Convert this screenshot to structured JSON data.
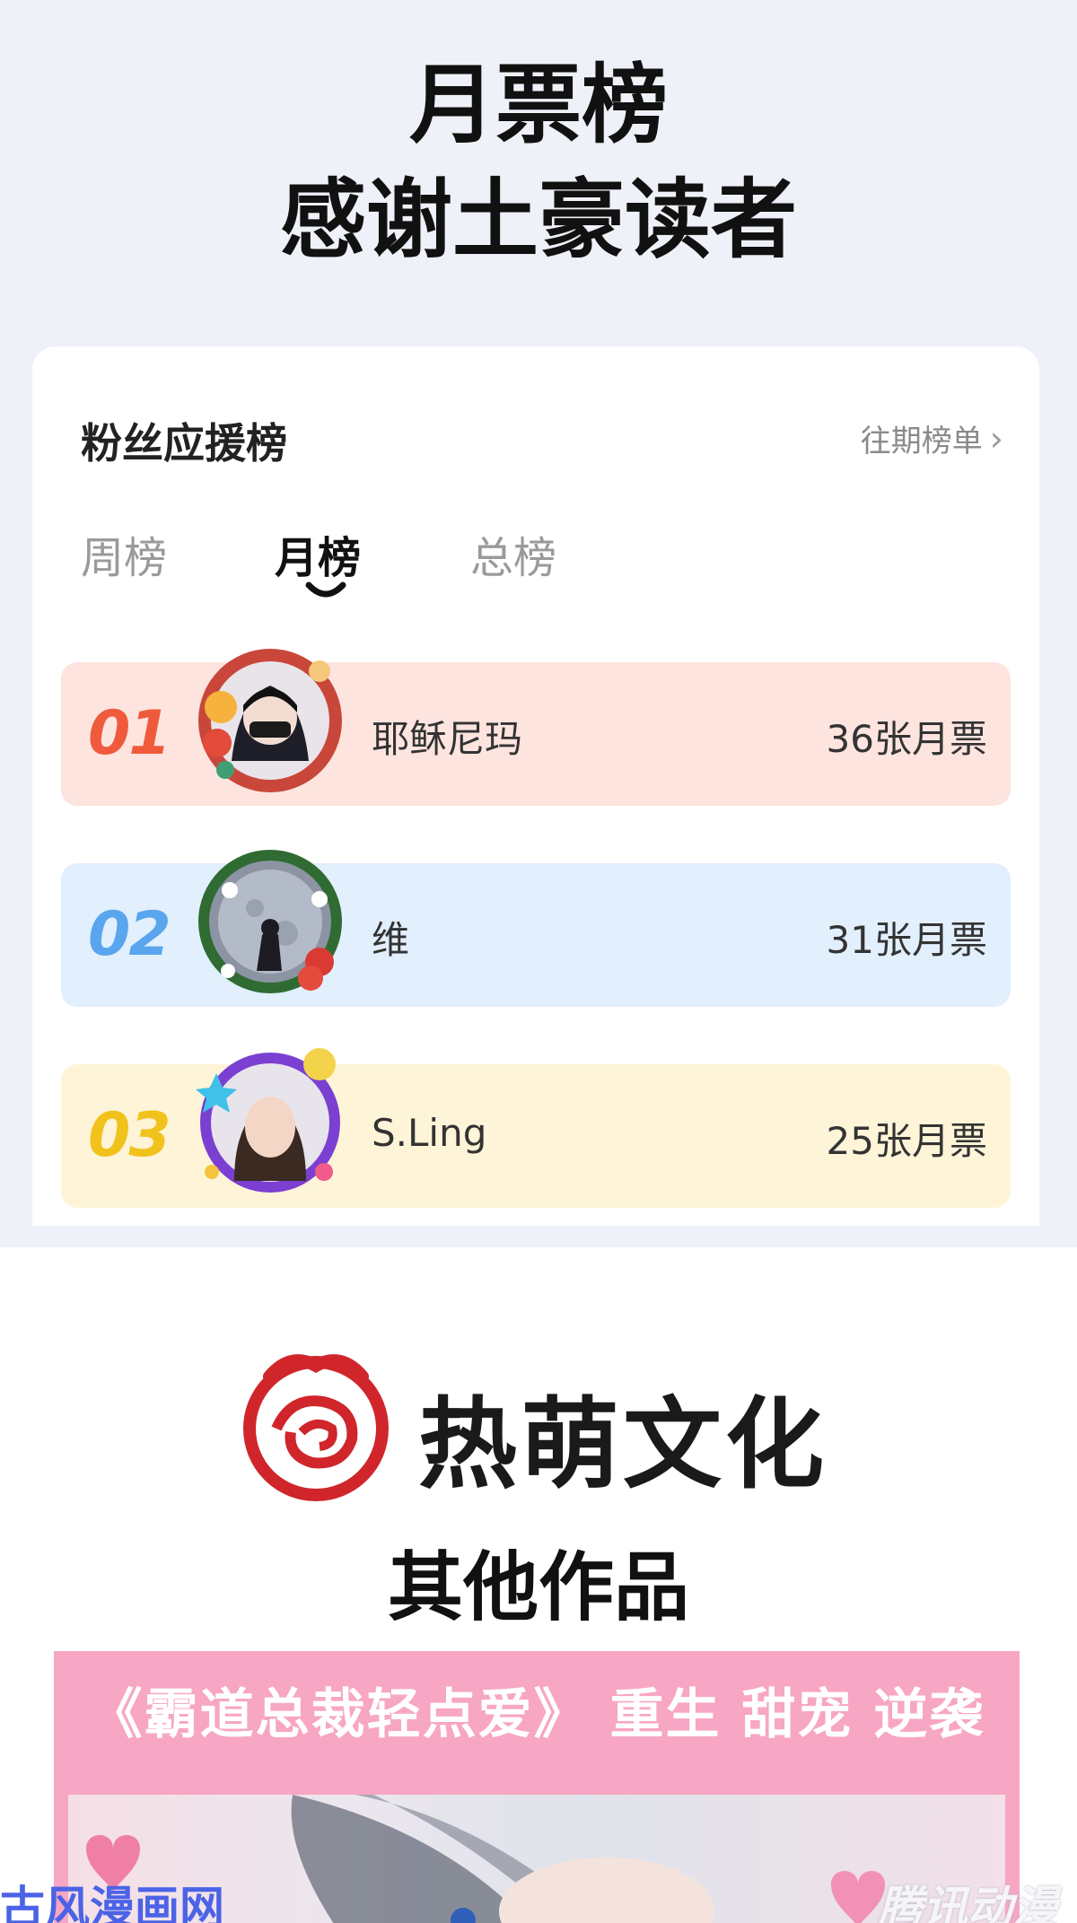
{
  "header": {
    "line1": "月票榜",
    "line2": "感谢土豪读者"
  },
  "card": {
    "title": "粉丝应援榜",
    "past_link": "往期榜单",
    "tabs": [
      "周榜",
      "月榜",
      "总榜"
    ],
    "active_tab": "月榜"
  },
  "ranking": [
    {
      "rank": "01",
      "name": "耶稣尼玛",
      "votes": "36张月票"
    },
    {
      "rank": "02",
      "name": "维",
      "votes": "31张月票"
    },
    {
      "rank": "03",
      "name": "S.Ling",
      "votes": "25张月票"
    }
  ],
  "brand": {
    "name": "热萌文化",
    "subtitle": "其他作品"
  },
  "promo": {
    "title": "《霸道总裁轻点爱》 重生  甜宠  逆袭"
  },
  "watermarks": {
    "left": "古风漫画网",
    "right": "腾讯动漫"
  },
  "colors": {
    "page_bg": "#eef1f7",
    "rank1_bg": "#fde4df",
    "rank2_bg": "#e2effd",
    "rank3_bg": "#fef4d8",
    "rank1_num": "#f05a3c",
    "rank2_num": "#5aa6ee",
    "rank3_num": "#f1c21b",
    "brand_red": "#d0262b",
    "promo_pink": "#f7a6c3"
  },
  "icons": [
    "chevron-right-icon",
    "tab-indicator-icon",
    "avatar",
    "brand-rose-logo-icon",
    "heart-icon"
  ]
}
